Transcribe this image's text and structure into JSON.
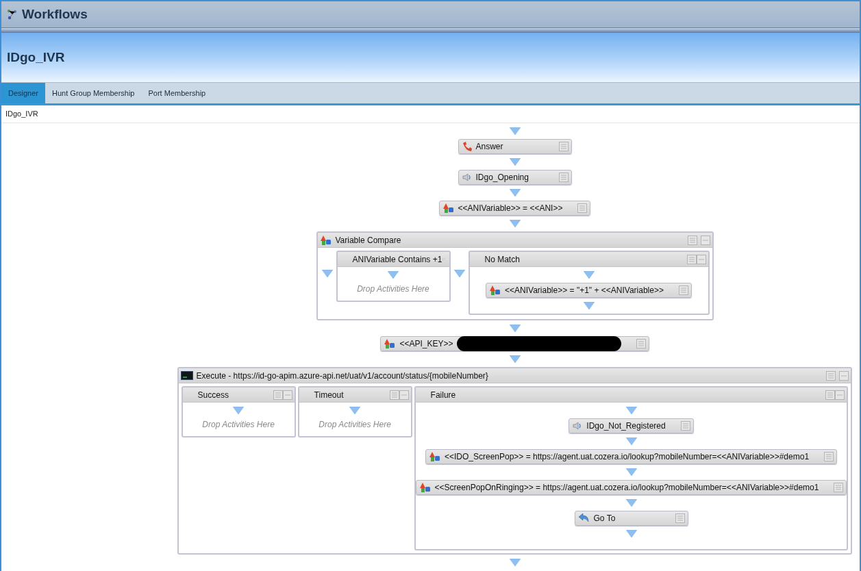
{
  "window": {
    "title": "Workflows"
  },
  "workflow": {
    "title": "IDgo_IVR"
  },
  "tabs": [
    {
      "label": "Designer",
      "selected": true
    },
    {
      "label": "Hunt Group Membership",
      "selected": false
    },
    {
      "label": "Port Membership",
      "selected": false
    }
  ],
  "breadcrumb": "IDgo_IVR",
  "flow": [
    {
      "kind": "answer",
      "label": "Answer"
    },
    {
      "kind": "prompt",
      "label": "IDgo_Opening"
    },
    {
      "kind": "assign",
      "label": "<<ANIVariable>> = <<ANI>>"
    },
    {
      "kind": "compare",
      "label": "Variable Compare",
      "branches": [
        {
          "label": "ANIVariable Contains +1",
          "placeholder": "Drop Activities Here"
        },
        {
          "label": "No Match",
          "children": [
            {
              "kind": "assign",
              "label": "<<ANIVariable>> = \"+1\" + <<ANIVariable>>"
            }
          ]
        }
      ]
    },
    {
      "kind": "redacted",
      "label": "<<API_KEY>>"
    },
    {
      "kind": "execute",
      "label": "Execute - https://id-go-apim.azure-api.net/uat/v1/account/status/{mobileNumber}",
      "branches": [
        {
          "label": "Success",
          "placeholder": "Drop Activities Here"
        },
        {
          "label": "Timeout",
          "placeholder": "Drop Activities Here"
        },
        {
          "label": "Failure",
          "children": [
            {
              "kind": "prompt",
              "label": "IDgo_Not_Registered"
            },
            {
              "kind": "assign",
              "label": "<<IDO_ScreenPop>> = https://agent.uat.cozera.io/lookup?mobileNumber=<<ANIVariable>>#demo1"
            },
            {
              "kind": "assign",
              "label": "<<ScreenPopOnRinging>> = https://agent.uat.cozera.io/lookup?mobileNumber=<<ANIVariable>>#demo1"
            },
            {
              "kind": "goto",
              "label": "Go To"
            }
          ]
        }
      ]
    }
  ]
}
